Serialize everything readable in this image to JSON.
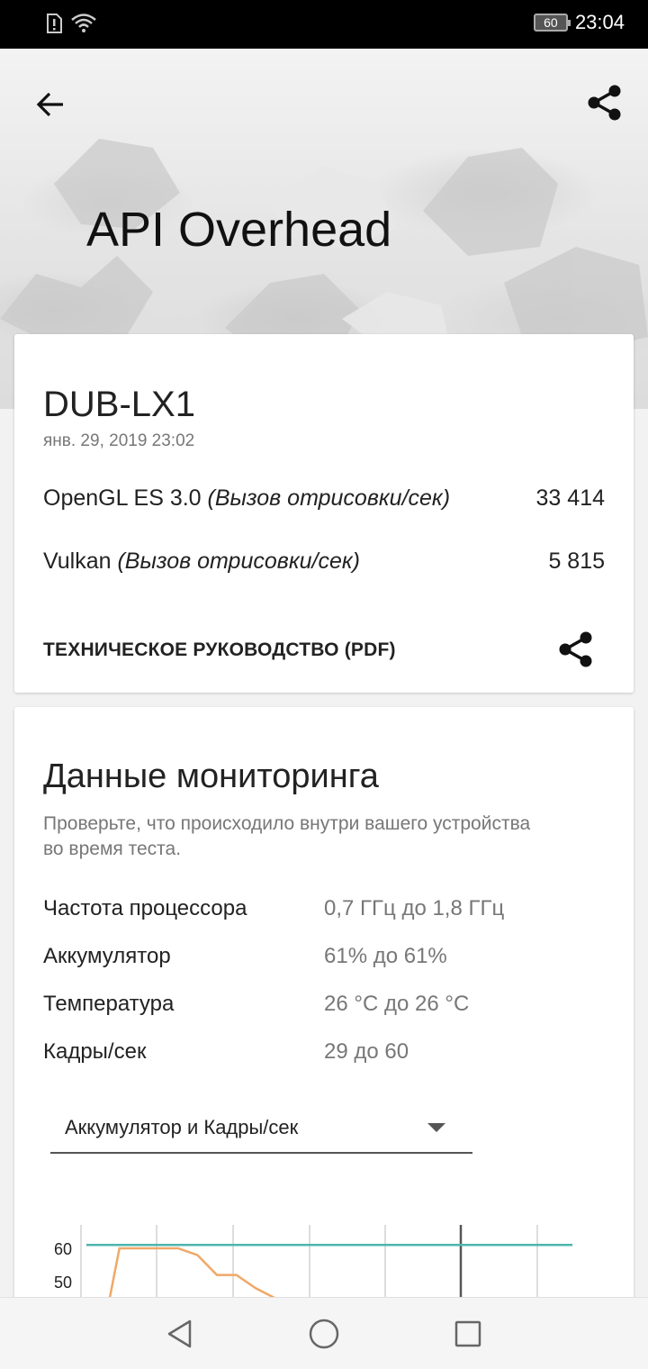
{
  "status_bar": {
    "time": "23:04",
    "battery": "60"
  },
  "header": {
    "title": "API Overhead"
  },
  "result_card": {
    "device": "DUB-LX1",
    "date": "янв. 29, 2019 23:02",
    "scores": [
      {
        "name": "OpenGL ES 3.0",
        "unit": "(Вызов отрисовки/сек)",
        "value": "33 414"
      },
      {
        "name": "Vulkan",
        "unit": "(Вызов отрисовки/сек)",
        "value": "5 815"
      }
    ],
    "manual_link": "ТЕХНИЧЕСКОЕ РУКОВОДСТВО (PDF)"
  },
  "monitoring": {
    "title": "Данные мониторинга",
    "description": "Проверьте, что происходило внутри вашего устройства во время теста.",
    "rows": [
      {
        "label": "Частота процессора",
        "value": "0,7 ГГц до 1,8 ГГц"
      },
      {
        "label": "Аккумулятор",
        "value": "61% до 61%"
      },
      {
        "label": "Температура",
        "value": "26 °C до 26 °C"
      },
      {
        "label": "Кадры/сек",
        "value": "29 до 60"
      }
    ],
    "select": {
      "selected": "Аккумулятор и Кадры/сек"
    }
  },
  "chart_data": {
    "type": "line",
    "y_ticks": [
      "60",
      "50"
    ],
    "series": [
      {
        "values": [
          30,
          60,
          60,
          60,
          60,
          58,
          52,
          52,
          48,
          45
        ],
        "color": "#f0a868"
      },
      {
        "values": [
          61,
          61,
          61,
          61,
          61,
          61,
          61,
          61,
          61,
          61
        ],
        "color": "#4db6ac"
      }
    ],
    "grid": true
  },
  "colors": {
    "accent_orange": "#f0a868",
    "accent_teal": "#4db6ac"
  },
  "icons": {
    "back": "arrow-left-icon",
    "share": "share-icon",
    "nav_back": "triangle-back-icon",
    "nav_home": "circle-home-icon",
    "nav_recent": "square-recents-icon"
  }
}
